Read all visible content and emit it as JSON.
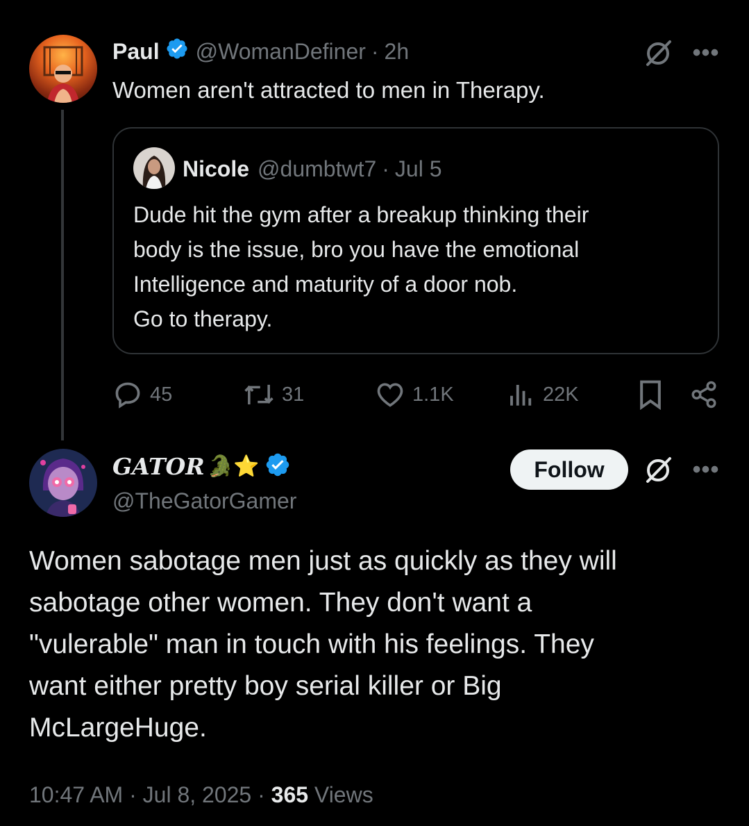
{
  "parent_post": {
    "display_name": "Paul",
    "handle": "@WomanDefiner",
    "separator": "·",
    "time": "2h",
    "text": "Women aren't attracted to men in Therapy.",
    "quote": {
      "display_name": "Nicole",
      "handle": "@dumbtwt7",
      "separator": "·",
      "time": "Jul 5",
      "lines": [
        "Dude hit the gym after a breakup thinking their",
        "body is the issue, bro you have the emotional",
        "Intelligence and maturity of a door nob.",
        "Go to therapy."
      ]
    },
    "stats": {
      "replies": "45",
      "reposts": "31",
      "likes": "1.1K",
      "views": "22K"
    }
  },
  "main_post": {
    "display_name": "GATOR",
    "emoji": "🐊⭐",
    "handle": "@TheGatorGamer",
    "follow_label": "Follow",
    "lines": [
      "Women sabotage men just as quickly as they will",
      "sabotage other women. They don't want a",
      "\"vulerable\" man in touch with his feelings. They",
      "want either pretty boy serial killer or Big",
      "McLargeHuge."
    ],
    "time": "10:47 AM",
    "separator1": "·",
    "date": "Jul 8, 2025",
    "separator2": "·",
    "views_count": "365",
    "views_label": "Views"
  },
  "colors": {
    "background": "#000000",
    "text": "#e7e9ea",
    "muted": "#71767b",
    "verified": "#1d9bf0",
    "border": "#2f3336"
  },
  "icons": [
    "verified-badge-icon",
    "grok-icon",
    "more-icon",
    "reply-icon",
    "repost-icon",
    "like-icon",
    "views-icon",
    "bookmark-icon",
    "share-icon"
  ]
}
